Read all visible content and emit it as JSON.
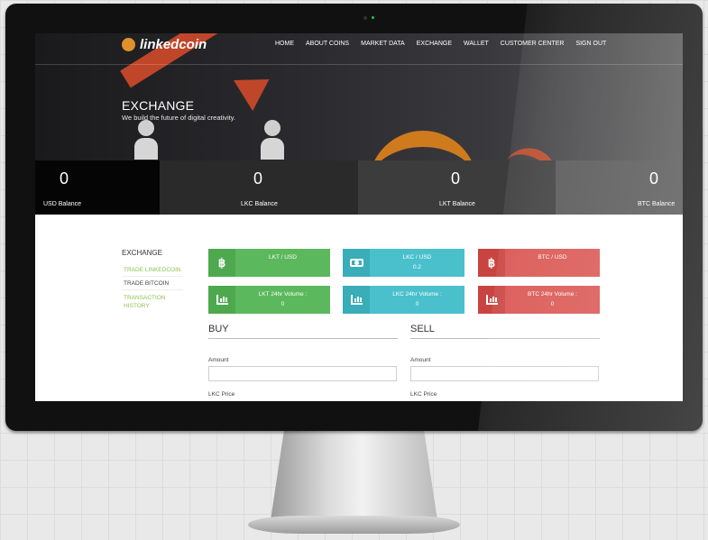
{
  "nav": {
    "logo_text": "linkedcoin",
    "items": [
      "HOME",
      "ABOUT COINS",
      "MARKET DATA",
      "EXCHANGE",
      "WALLET",
      "CUSTOMER CENTER",
      "SIGN OUT"
    ]
  },
  "hero": {
    "title": "EXCHANGE",
    "subtitle": "We build the future of digital creativity."
  },
  "balances": [
    {
      "value": "0",
      "label": "USD Balance"
    },
    {
      "value": "0",
      "label": "LKC Balance"
    },
    {
      "value": "0",
      "label": "LKT Balance"
    },
    {
      "value": "0",
      "label": "BTC Balance"
    }
  ],
  "sidebar": {
    "title": "EXCHANGE",
    "items": [
      "TRADE LINKEDCOIN",
      "TRADE BITCOIN",
      "TRANSACTION",
      "HISTORY"
    ]
  },
  "cards": {
    "lkt_usd": {
      "title": "LKT / USD",
      "value": ""
    },
    "lkc_usd": {
      "title": "LKC / USD",
      "value": "0.2"
    },
    "btc_usd": {
      "title": "BTC / USD",
      "value": ""
    },
    "lkt_vol": {
      "title": "LKT 24hr Volume :",
      "value": "0"
    },
    "lkc_vol": {
      "title": "LKC 24hr Volume :",
      "value": "0"
    },
    "btc_vol": {
      "title": "BTC 24hr Volume :",
      "value": "0"
    }
  },
  "buy": {
    "title": "BUY",
    "amount_label": "Amount",
    "price_label": "LKC Price"
  },
  "sell": {
    "title": "SELL",
    "amount_label": "Amount",
    "price_label": "LKC Price"
  },
  "colors": {
    "green": "#5cb85c",
    "teal": "#4ac0cc",
    "red": "#d9534f",
    "sidebar_link": "#8cc152"
  }
}
